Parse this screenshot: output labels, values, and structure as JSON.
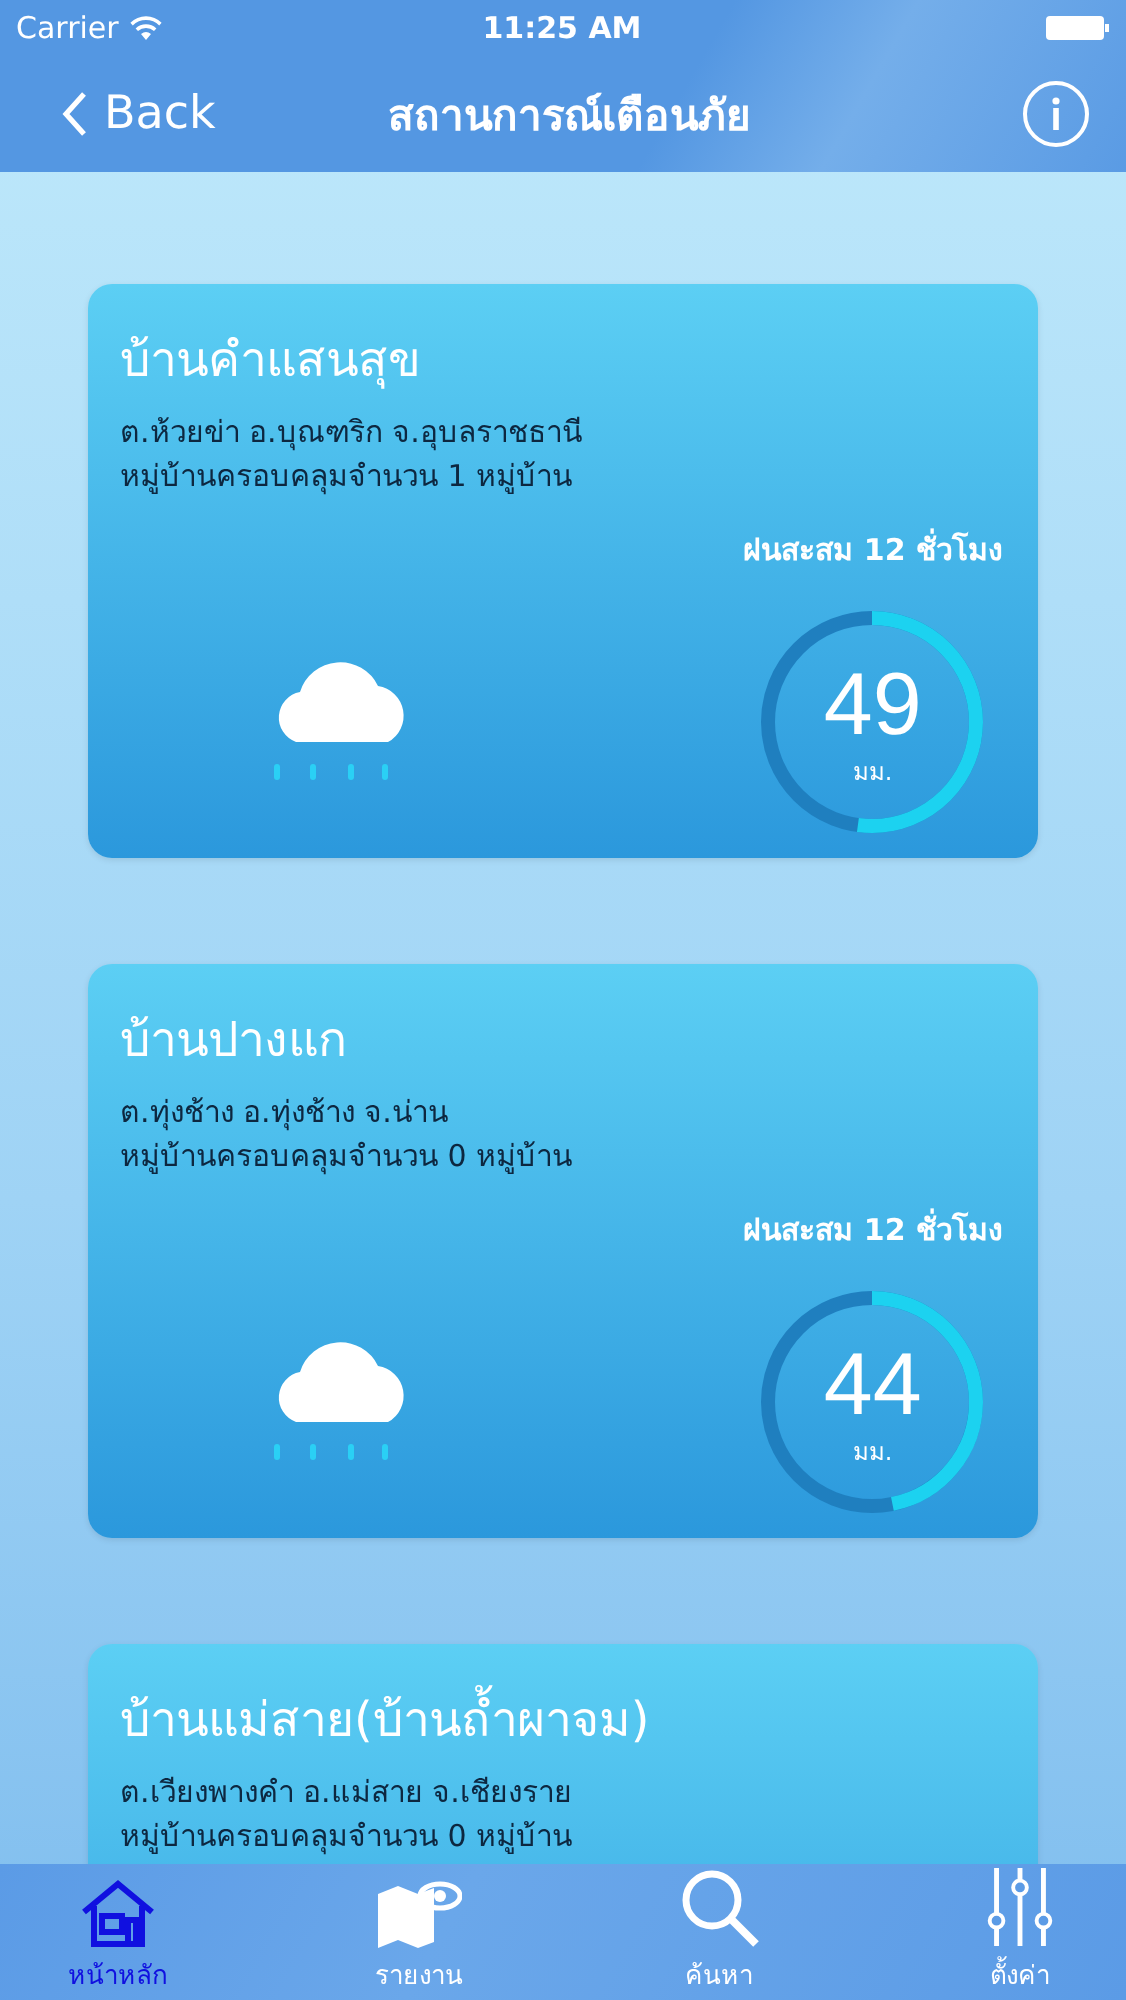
{
  "status_bar": {
    "carrier": "Carrier",
    "time": "11:25 AM"
  },
  "nav": {
    "back": "Back",
    "title": "สถานการณ์เตือนภัย"
  },
  "cards": [
    {
      "title": "บ้านคำแสนสุข",
      "location": "ต.ห้วยข่า อ.บุณฑริก จ.อุบลราชธานี",
      "coverage": "หมู่บ้านครอบคลุมจำนวน 1 หมู่บ้าน",
      "gauge": {
        "label": "ฝนสะสม 12 ชั่วโมง",
        "value": "49",
        "unit": "มม."
      }
    },
    {
      "title": "บ้านปางแก",
      "location": "ต.ทุ่งช้าง อ.ทุ่งช้าง จ.น่าน",
      "coverage": "หมู่บ้านครอบคลุมจำนวน 0 หมู่บ้าน",
      "gauge": {
        "label": "ฝนสะสม 12 ชั่วโมง",
        "value": "44",
        "unit": "มม."
      }
    },
    {
      "title": "บ้านแม่สาย(บ้านถ้ำผาจม)",
      "location": "ต.เวียงพางคำ อ.แม่สาย จ.เชียงราย",
      "coverage": "หมู่บ้านครอบคลุมจำนวน 0 หมู่บ้าน"
    }
  ],
  "tabs": [
    {
      "label": "หน้าหลัก",
      "kind": "home",
      "selected": true
    },
    {
      "label": "รายงาน",
      "kind": "map",
      "selected": false
    },
    {
      "label": "ค้นหา",
      "kind": "search",
      "selected": false
    },
    {
      "label": "ตั้งค่า",
      "kind": "settings",
      "selected": false
    }
  ]
}
